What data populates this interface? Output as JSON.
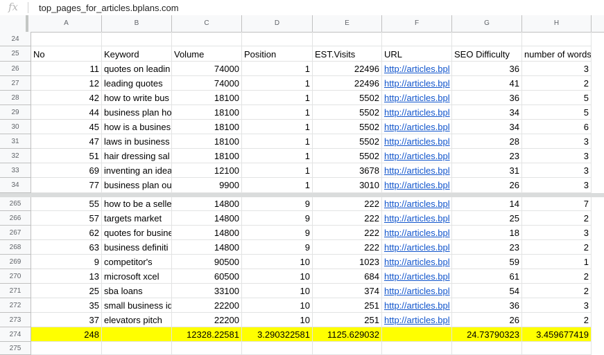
{
  "formula_bar": {
    "fx": "fx",
    "value": "top_pages_for_articles.bplans.com"
  },
  "columns": [
    "A",
    "B",
    "C",
    "D",
    "E",
    "F",
    "G",
    "H"
  ],
  "rows": [
    {
      "n": "24",
      "c": [
        "",
        "",
        "",
        "",
        "",
        "",
        "",
        ""
      ]
    },
    {
      "n": "25",
      "c": [
        "No",
        "Keyword",
        "Volume",
        "Position",
        "EST.Visits",
        "URL",
        "SEO Difficulty",
        "number of words"
      ],
      "header": true
    },
    {
      "n": "26",
      "c": [
        "11",
        "quotes on leadin",
        "74000",
        "1",
        "22496",
        "http://articles.bpl",
        "36",
        "3"
      ]
    },
    {
      "n": "27",
      "c": [
        "12",
        "leading quotes",
        "74000",
        "1",
        "22496",
        "http://articles.bpl",
        "41",
        "2"
      ]
    },
    {
      "n": "28",
      "c": [
        "42",
        "how to write bus",
        "18100",
        "1",
        "5502",
        "http://articles.bpl",
        "36",
        "5"
      ]
    },
    {
      "n": "29",
      "c": [
        "44",
        "business plan ho",
        "18100",
        "1",
        "5502",
        "http://articles.bpl",
        "34",
        "5"
      ]
    },
    {
      "n": "30",
      "c": [
        "45",
        "how is a busines",
        "18100",
        "1",
        "5502",
        "http://articles.bpl",
        "34",
        "6"
      ]
    },
    {
      "n": "31",
      "c": [
        "47",
        "laws in business",
        "18100",
        "1",
        "5502",
        "http://articles.bpl",
        "28",
        "3"
      ]
    },
    {
      "n": "32",
      "c": [
        "51",
        "hair dressing sal",
        "18100",
        "1",
        "5502",
        "http://articles.bpl",
        "23",
        "3"
      ]
    },
    {
      "n": "33",
      "c": [
        "69",
        "inventing an idea",
        "12100",
        "1",
        "3678",
        "http://articles.bpl",
        "31",
        "3"
      ]
    },
    {
      "n": "34",
      "c": [
        "77",
        "business plan ou",
        "9900",
        "1",
        "3010",
        "http://articles.bpl",
        "26",
        "3"
      ]
    },
    {
      "n": "265",
      "c": [
        "55",
        "how to be a selle",
        "14800",
        "9",
        "222",
        "http://articles.bpl",
        "14",
        "7"
      ]
    },
    {
      "n": "266",
      "c": [
        "57",
        "targets market",
        "14800",
        "9",
        "222",
        "http://articles.bpl",
        "25",
        "2"
      ]
    },
    {
      "n": "267",
      "c": [
        "62",
        "quotes for busine",
        "14800",
        "9",
        "222",
        "http://articles.bpl",
        "18",
        "3"
      ]
    },
    {
      "n": "268",
      "c": [
        "63",
        "business definiti",
        "14800",
        "9",
        "222",
        "http://articles.bpl",
        "23",
        "2"
      ]
    },
    {
      "n": "269",
      "c": [
        "9",
        "competitor's",
        "90500",
        "10",
        "1023",
        "http://articles.bpl",
        "59",
        "1"
      ]
    },
    {
      "n": "270",
      "c": [
        "13",
        "microsoft xcel",
        "60500",
        "10",
        "684",
        "http://articles.bpl",
        "61",
        "2"
      ]
    },
    {
      "n": "271",
      "c": [
        "25",
        "sba loans",
        "33100",
        "10",
        "374",
        "http://articles.bpl",
        "54",
        "2"
      ]
    },
    {
      "n": "272",
      "c": [
        "35",
        "small business id",
        "22200",
        "10",
        "251",
        "http://articles.bpl",
        "36",
        "3"
      ]
    },
    {
      "n": "273",
      "c": [
        "37",
        "elevators pitch",
        "22200",
        "10",
        "251",
        "http://articles.bpl",
        "26",
        "2"
      ]
    },
    {
      "n": "274",
      "c": [
        "248",
        "",
        "12328.22581",
        "3.290322581",
        "1125.629032",
        "",
        "24.73790323",
        "3.459677419"
      ],
      "total": true
    },
    {
      "n": "275",
      "c": [
        "",
        "",
        "",
        "",
        "",
        "",
        "",
        ""
      ]
    }
  ],
  "colors": {
    "highlight": "#ffff00",
    "link": "#1155cc",
    "header_bg": "#f8f9fa"
  }
}
